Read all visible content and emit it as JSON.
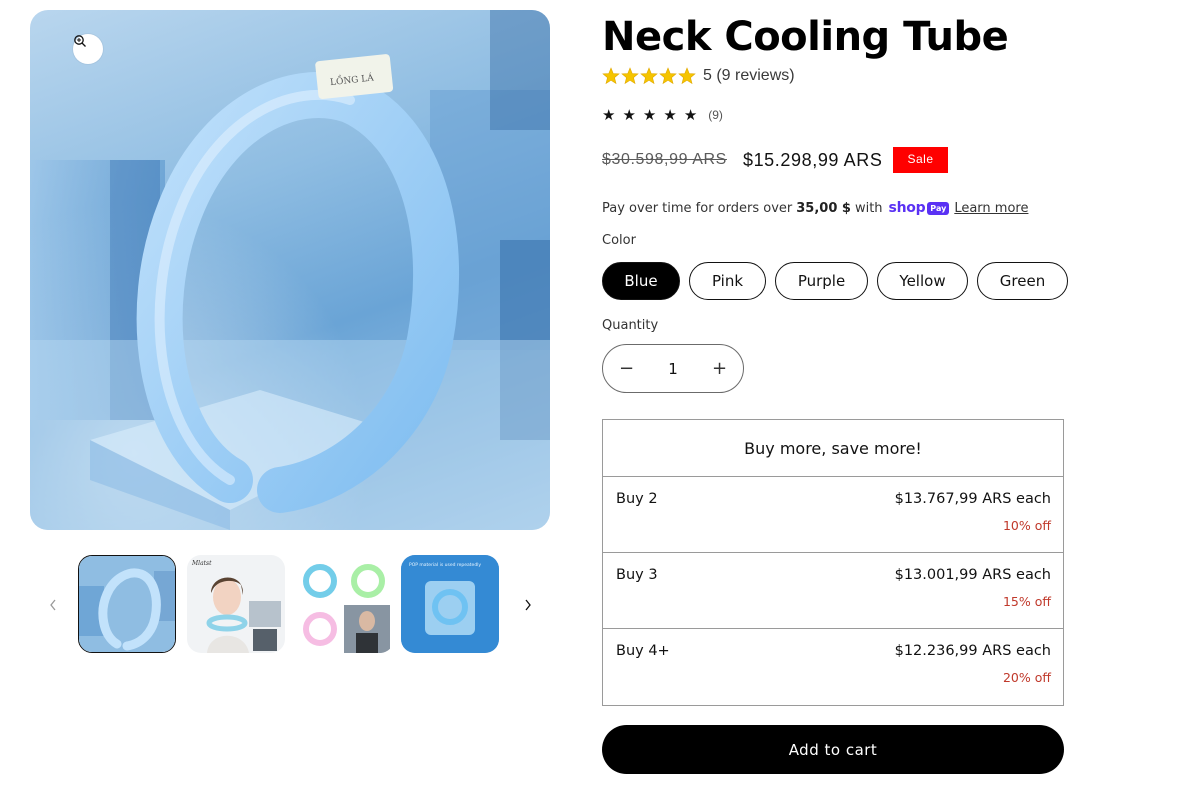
{
  "product": {
    "title": "Neck Cooling Tube",
    "rating_text": "5 (9 reviews)",
    "rating_value": 5,
    "rating_count_small": "(9)",
    "price_compare": "$30.598,99 ARS",
    "price_sale": "$15.298,99 ARS",
    "sale_badge": "Sale"
  },
  "installments": {
    "prefix": "Pay over time for orders over",
    "threshold": "35,00 $",
    "with": "with",
    "shop_word": "shop",
    "pay_badge": "Pay",
    "learn_more": "Learn more"
  },
  "options": {
    "color_label": "Color",
    "colors": [
      "Blue",
      "Pink",
      "Purple",
      "Yellow",
      "Green"
    ],
    "selected_color": "Blue"
  },
  "quantity": {
    "label": "Quantity",
    "value": "1",
    "minus": "−",
    "plus": "+"
  },
  "bundle": {
    "heading": "Buy more, save more!",
    "tiers": [
      {
        "name": "Buy 2",
        "price": "$13.767,99 ARS each",
        "discount": "10% off"
      },
      {
        "name": "Buy 3",
        "price": "$13.001,99 ARS each",
        "discount": "15% off"
      },
      {
        "name": "Buy 4+",
        "price": "$12.236,99 ARS each",
        "discount": "20% off"
      }
    ]
  },
  "cart": {
    "add_label": "Add to cart"
  },
  "media": {
    "thumbnail_count": 4,
    "active_thumbnail": 1,
    "tag_text": "LỒNG LÁ",
    "thumb4_caption": "POP material is used repeatedly",
    "thumb2_brand": "Mlatst"
  },
  "colors": {
    "accent": "#000000",
    "sale": "#ff0000",
    "discount": "#c0392b",
    "shop_pay": "#5a31f4",
    "star": "#f5c400"
  }
}
